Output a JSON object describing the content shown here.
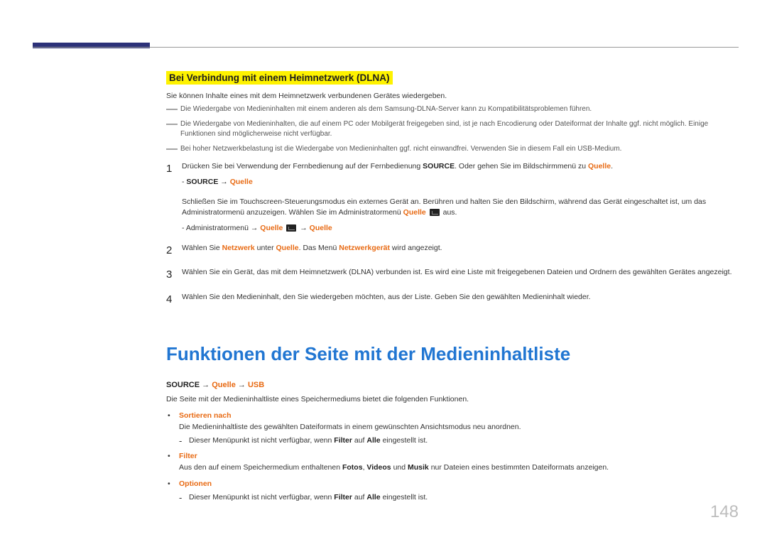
{
  "page_number": "148",
  "section1": {
    "heading": "Bei Verbindung mit einem Heimnetzwerk (DLNA)",
    "intro": "Sie können Inhalte eines mit dem Heimnetzwerk verbundenen Gerätes wiedergeben.",
    "notes": [
      "Die Wiedergabe von Medieninhalten mit einem anderen als dem Samsung-DLNA-Server kann zu Kompatibilitätsproblemen führen.",
      "Die Wiedergabe von Medieninhalten, die auf einem PC oder Mobilgerät freigegeben sind, ist je nach Encodierung oder Dateiformat der Inhalte ggf. nicht möglich. Einige Funktionen sind möglicherweise nicht verfügbar.",
      "Bei hoher Netzwerkbelastung ist die Wiedergabe von Medieninhalten ggf. nicht einwandfrei. Verwenden Sie in diesem Fall ein USB-Medium."
    ],
    "step1": {
      "num": "1",
      "t1a": "Drücken Sie bei Verwendung der Fernbedienung auf der Fernbedienung ",
      "t1b": "SOURCE",
      "t1c": ". Oder gehen Sie im Bildschirmmenü zu ",
      "t1d": "Quelle",
      "t1e": ".",
      "bc_a": "- ",
      "bc_b": "SOURCE",
      "bc_arrow": " → ",
      "bc_c": "Quelle",
      "t2a": "Schließen Sie im Touchscreen-Steuerungsmodus ein externes Gerät an. Berühren und halten Sie den Bildschirm, während das Gerät eingeschaltet ist, um das Administratormenü anzuzeigen. Wählen Sie im Administratormenü ",
      "t2b": "Quelle",
      "t2c": " aus.",
      "bc2_a": "- Administratormenü → ",
      "bc2_b": "Quelle",
      "bc2_c": " → ",
      "bc2_d": "Quelle"
    },
    "step2": {
      "num": "2",
      "a": "Wählen Sie ",
      "b": "Netzwerk",
      "c": " unter ",
      "d": "Quelle",
      "e": ". Das Menü ",
      "f": "Netzwerkgerät",
      "g": " wird angezeigt."
    },
    "step3": {
      "num": "3",
      "text": "Wählen Sie ein Gerät, das mit dem Heimnetzwerk (DLNA) verbunden ist. Es wird eine Liste mit freigegebenen Dateien und Ordnern des gewählten Gerätes angezeigt."
    },
    "step4": {
      "num": "4",
      "text": "Wählen Sie den Medieninhalt, den Sie wiedergeben möchten, aus der Liste. Geben Sie den gewählten Medieninhalt wieder."
    }
  },
  "section2": {
    "heading": "Funktionen der Seite mit der Medieninhaltliste",
    "bc_a": "SOURCE",
    "bc_arrow1": " → ",
    "bc_b": "Quelle",
    "bc_arrow2": " → ",
    "bc_c": "USB",
    "desc": "Die Seite mit der Medieninhaltliste eines Speichermediums bietet die folgenden Funktionen.",
    "b1": {
      "title": "Sortieren nach",
      "desc": "Die Medieninhaltliste des gewählten Dateiformats in einem gewünschten Ansichtsmodus neu anordnen.",
      "note_a": "Dieser Menüpunkt ist nicht verfügbar, wenn ",
      "note_b": "Filter",
      "note_c": " auf ",
      "note_d": "Alle",
      "note_e": " eingestellt ist."
    },
    "b2": {
      "title": "Filter",
      "a": "Aus den auf einem Speichermedium enthaltenen ",
      "b": "Fotos",
      "c": ", ",
      "d": "Videos",
      "e": " und ",
      "f": "Musik",
      "g": " nur Dateien eines bestimmten Dateiformats anzeigen."
    },
    "b3": {
      "title": "Optionen",
      "note_a": "Dieser Menüpunkt ist nicht verfügbar, wenn ",
      "note_b": "Filter",
      "note_c": " auf ",
      "note_d": "Alle",
      "note_e": " eingestellt ist."
    }
  }
}
